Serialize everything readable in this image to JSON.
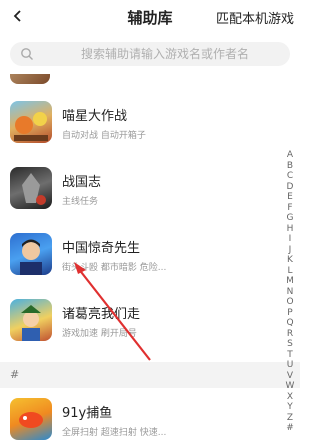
{
  "header": {
    "title": "辅助库",
    "match_label": "匹配本机游戏"
  },
  "search": {
    "placeholder": "搜索辅助请输入游戏名或作者名"
  },
  "games": [
    {
      "name": "喵星大作战",
      "desc": "自动对战 自动开箱子"
    },
    {
      "name": "战国志",
      "desc": "主线任务"
    },
    {
      "name": "中国惊奇先生",
      "desc": "街头斗殴 都市暗影 危险..."
    },
    {
      "name": "诸葛亮我们走",
      "desc": "游戏加速 刷开局号"
    },
    {
      "name": "91y捕鱼",
      "desc": "全屏扫射 超速扫射 快速..."
    }
  ],
  "section_label": "#",
  "alphabet": [
    "A",
    "B",
    "C",
    "D",
    "E",
    "F",
    "G",
    "H",
    "I",
    "J",
    "K",
    "L",
    "M",
    "N",
    "O",
    "P",
    "Q",
    "R",
    "S",
    "T",
    "U",
    "V",
    "W",
    "X",
    "Y",
    "Z",
    "#"
  ],
  "colors": {
    "arrow": "#e03030",
    "section_bg": "#f3f3f3"
  }
}
